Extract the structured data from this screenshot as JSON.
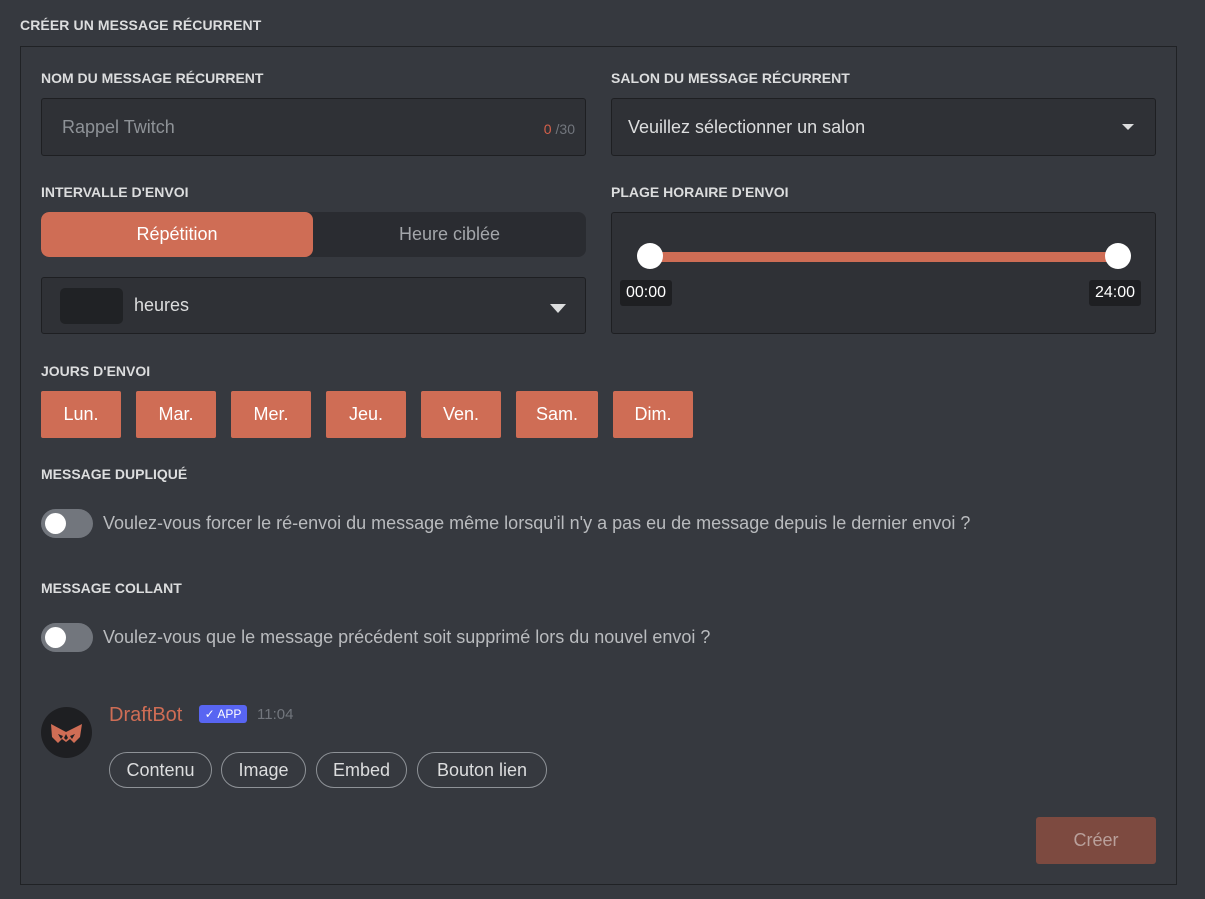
{
  "section_title": "CRÉER UN MESSAGE RÉCURRENT",
  "name_field": {
    "label": "NOM DU MESSAGE RÉCURRENT",
    "placeholder": "Rappel Twitch",
    "count_current": "0",
    "count_max": "/30"
  },
  "salon_field": {
    "label": "SALON DU MESSAGE RÉCURRENT",
    "value": "Veuillez sélectionner un salon"
  },
  "interval": {
    "label": "INTERVALLE D'ENVOI",
    "tabs": [
      "Répétition",
      "Heure ciblée"
    ],
    "active_tab": "Répétition",
    "unit": "heures"
  },
  "time_range": {
    "label": "PLAGE HORAIRE D'ENVOI",
    "start": "00:00",
    "end": "24:00"
  },
  "days": {
    "label": "JOURS D'ENVOI",
    "items": [
      "Lun.",
      "Mar.",
      "Mer.",
      "Jeu.",
      "Ven.",
      "Sam.",
      "Dim."
    ]
  },
  "duplicate": {
    "label": "MESSAGE DUPLIQUÉ",
    "text": "Voulez-vous forcer le ré-envoi du message même lorsqu'il n'y a pas eu de message depuis le dernier envoi ?",
    "enabled": false
  },
  "sticky": {
    "label": "MESSAGE COLLANT",
    "text": "Voulez-vous que le message précédent soit supprimé lors du nouvel envoi ?",
    "enabled": false
  },
  "preview": {
    "bot_name": "DraftBot",
    "badge": "✓ APP",
    "time": "11:04",
    "buttons": [
      "Contenu",
      "Image",
      "Embed",
      "Bouton lien"
    ]
  },
  "submit_label": "Créer",
  "colors": {
    "accent": "#cf6d55",
    "background": "#36393f",
    "input_bg": "#2f3136",
    "badge": "#5865f2"
  }
}
